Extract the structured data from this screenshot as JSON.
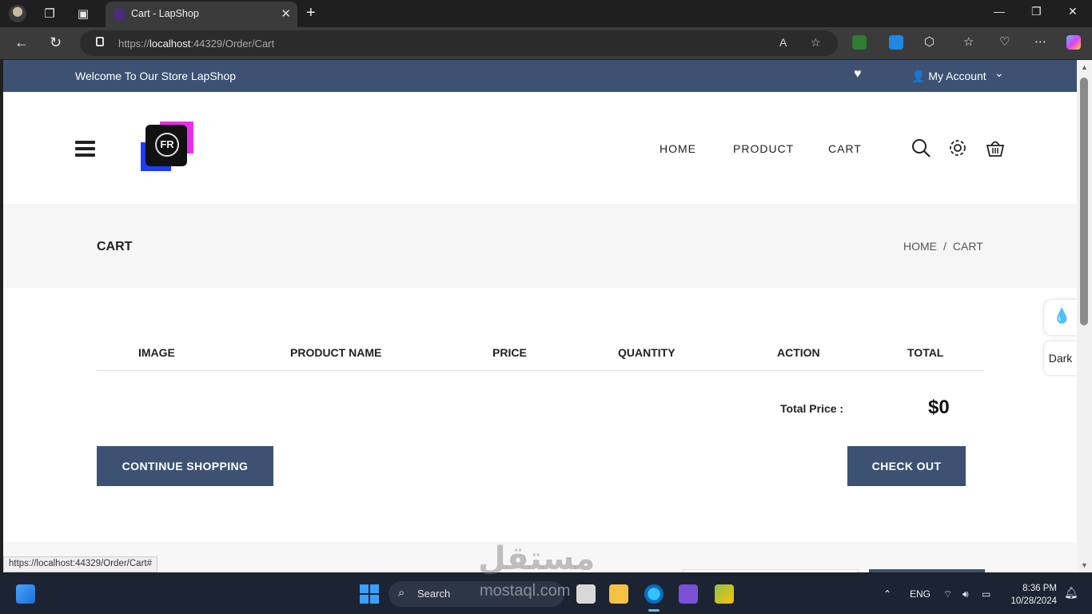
{
  "browser": {
    "tab_title": "Cart - LapShop",
    "tab_close": "✕",
    "new_tab": "+",
    "url_prefix": "https://",
    "url_host": "localhost",
    "url_rest": ":44329/Order/Cart",
    "status_url": "https://localhost:44329/Order/Cart#",
    "window_controls": [
      "—",
      "❐",
      "✕"
    ]
  },
  "topbar": {
    "welcome": "Welcome To Our Store LapShop",
    "account": "My Account"
  },
  "nav": {
    "items": [
      "HOME",
      "PRODUCT",
      "CART"
    ]
  },
  "banner": {
    "title": "CART",
    "breadcrumb": [
      "HOME",
      "CART"
    ],
    "separator": "/"
  },
  "cart": {
    "columns": [
      "IMAGE",
      "PRODUCT NAME",
      "PRICE",
      "QUANTITY",
      "ACTION",
      "TOTAL"
    ],
    "total_label": "Total Price :",
    "total_value": "$0",
    "continue_label": "CONTINUE SHOPPING",
    "checkout_label": "CHECK OUT"
  },
  "float": {
    "dark_label": "Dark"
  },
  "taskbar": {
    "search_label": "Search",
    "language": "ENG",
    "time": "8:36 PM",
    "date": "10/28/2024"
  },
  "watermark": {
    "arabic": "مستقل",
    "latin": "mostaql.com"
  },
  "colors": {
    "accent": "#3d5273",
    "page_bg": "#ffffff",
    "banner_bg": "#f6f6f6"
  }
}
